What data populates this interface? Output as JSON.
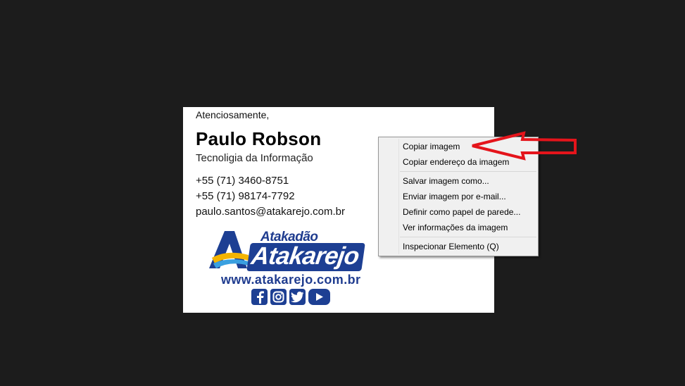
{
  "signature": {
    "greeting": "Atenciosamente,",
    "name": "Paulo Robson",
    "department": "Tecnoligia da Informação",
    "phone1": "+55  (71) 3460-8751",
    "phone2": "+55  (71) 98174-7792",
    "email": "paulo.santos@atakarejo.com.br",
    "logo": {
      "small_text": "Atakadão",
      "big_text": "Atakarejo",
      "website": "www.atakarejo.com.br"
    },
    "social_icons": [
      "facebook-icon",
      "instagram-icon",
      "twitter-icon",
      "youtube-icon"
    ]
  },
  "context_menu": {
    "group1": [
      "Copiar imagem",
      "Copiar endereço da imagem"
    ],
    "group2": [
      "Salvar imagem como...",
      "Enviar imagem por e-mail...",
      "Definir como papel de parede...",
      "Ver informações da imagem"
    ],
    "group3": [
      "Inspecionar Elemento (Q)"
    ]
  },
  "annotation": {
    "arrow_color": "#e4141b",
    "points_to": "Copiar imagem"
  },
  "colors": {
    "background": "#1c1c1c",
    "brand_blue": "#1d3f93",
    "brand_yellow": "#f4b400"
  }
}
